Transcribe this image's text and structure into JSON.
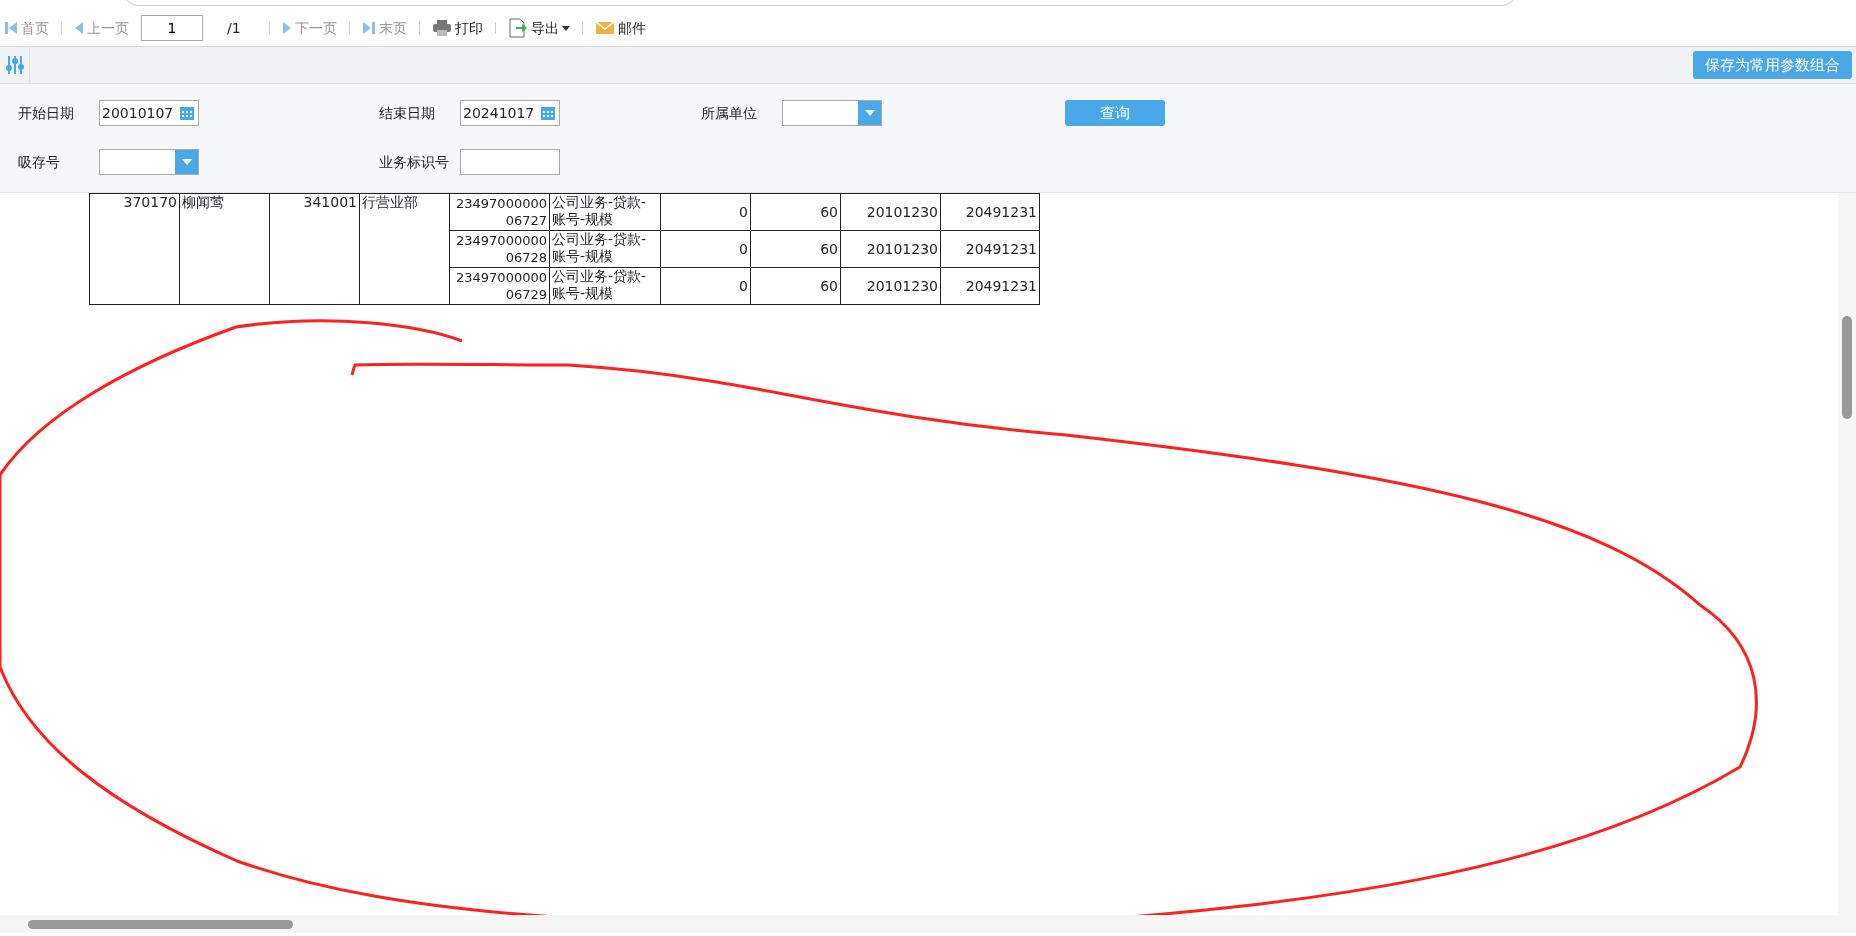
{
  "toolbar": {
    "items": [
      {
        "kind": "first",
        "label": "首页",
        "disabled": true
      },
      {
        "kind": "prev",
        "label": "上一页",
        "disabled": true
      },
      {
        "kind": "page",
        "value": "1",
        "total": "/1"
      },
      {
        "kind": "next",
        "label": "下一页",
        "disabled": true
      },
      {
        "kind": "last",
        "label": "末页",
        "disabled": true
      },
      {
        "kind": "print",
        "label": "打印",
        "disabled": false
      },
      {
        "kind": "export",
        "label": "导出",
        "disabled": false
      },
      {
        "kind": "mail",
        "label": "邮件",
        "disabled": false
      }
    ]
  },
  "params": {
    "save_button": "保存为常用参数组合",
    "query_button": "查询",
    "fields": [
      {
        "kind": "date",
        "label": "开始日期",
        "value": "20010107"
      },
      {
        "kind": "date",
        "label": "结束日期",
        "value": "20241017"
      },
      {
        "kind": "select",
        "label": "所属单位"
      },
      {
        "kind": "select",
        "label": "吸存号"
      },
      {
        "kind": "text",
        "label": "业务标识号"
      }
    ]
  },
  "table": {
    "groups": [
      {
        "cells": [
          "370170",
          "柳闻莺",
          "341001",
          "行营业部"
        ],
        "rows": [
          [
            "23497000000 06727",
            "公司业务-贷款-账号-规模",
            "0",
            "60",
            "20101230",
            "20491231"
          ],
          [
            "23497000000 06728",
            "公司业务-贷款-账号-规模",
            "0",
            "60",
            "20101230",
            "20491231"
          ],
          [
            "23497000000 06729",
            "公司业务-贷款-账号-规模",
            "0",
            "60",
            "20101230",
            "20491231"
          ]
        ]
      }
    ]
  }
}
